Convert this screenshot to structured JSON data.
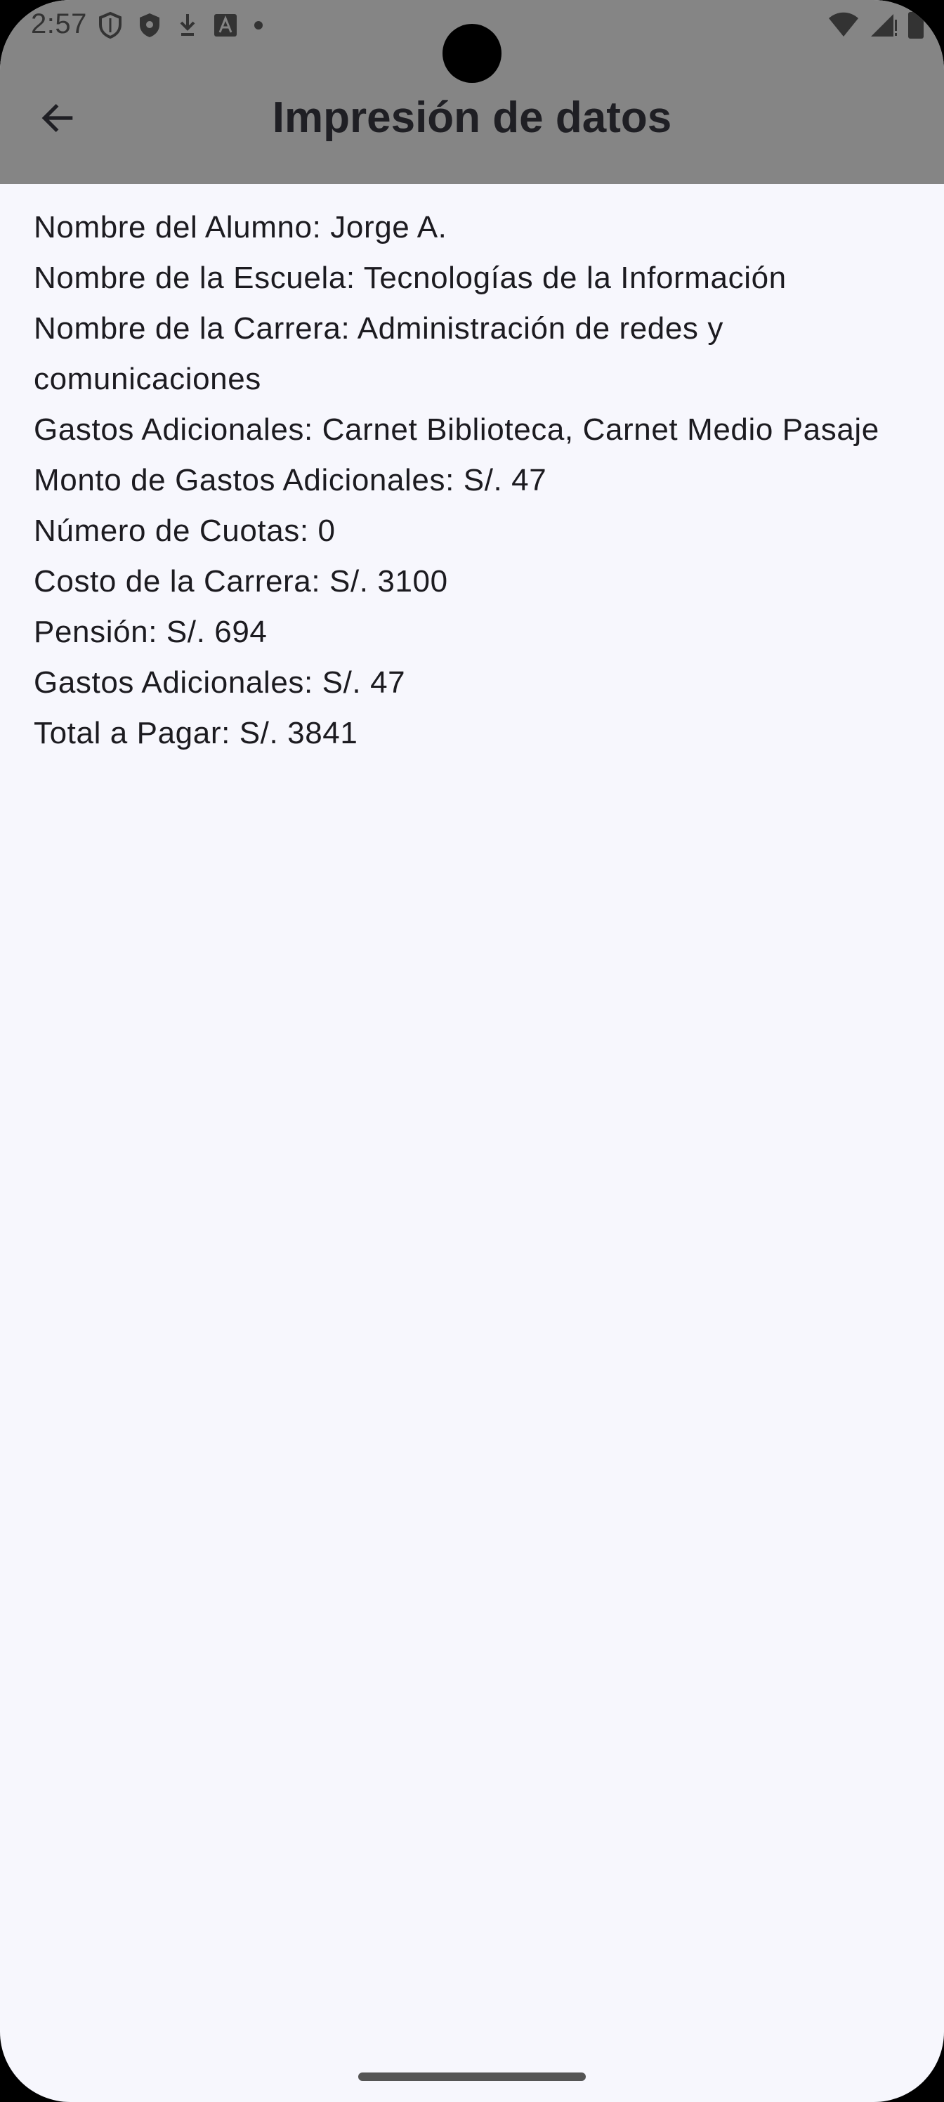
{
  "status_bar": {
    "time": "2:57",
    "left_icons": [
      "shield-outline-icon",
      "shield-filled-icon",
      "download-icon",
      "font-a-icon",
      "dot-icon"
    ],
    "right_icons": [
      "wifi-icon",
      "signal-icon",
      "battery-icon"
    ]
  },
  "app_bar": {
    "back_icon": "arrow-back-icon",
    "title": "Impresión de datos"
  },
  "details": [
    "Nombre del Alumno: Jorge A.",
    "Nombre de la Escuela: Tecnologías de la Información",
    "Nombre de la Carrera: Administración de redes y comunicaciones",
    "Gastos Adicionales: Carnet Biblioteca, Carnet Medio Pasaje",
    "Monto de Gastos Adicionales: S/. 47",
    "Número de Cuotas: 0",
    "Costo de la Carrera: S/. 3100",
    "Pensión: S/. 694",
    "Gastos Adicionales: S/. 47",
    "Total a Pagar: S/. 3841"
  ],
  "colors": {
    "top_bar": "#858585",
    "background": "#f7f7fd",
    "text": "#1c1b20"
  }
}
